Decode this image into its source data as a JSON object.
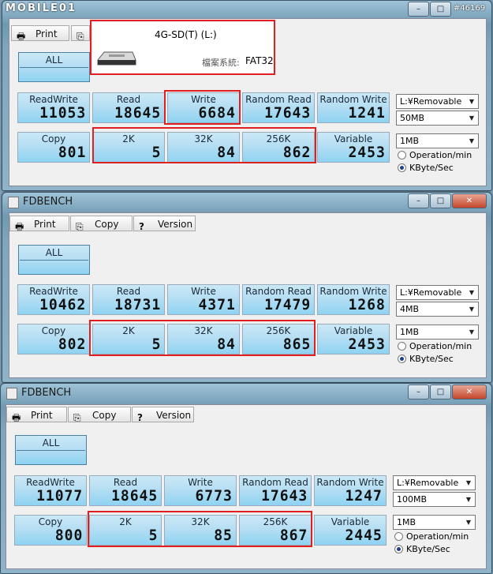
{
  "watermark": {
    "logo": "MOBILE01",
    "id": "#46169"
  },
  "drive_info": {
    "name": "4G-SD(T) (L:)",
    "fs_label": "檔案系統:",
    "fs_value": "FAT32"
  },
  "windows": [
    {
      "title": "",
      "toolbar": {
        "print": "Print",
        "copy": "",
        "version": ""
      },
      "tiles": {
        "all": "ALL",
        "row1": [
          {
            "label": "ReadWrite",
            "value": "11053"
          },
          {
            "label": "Read",
            "value": "18645"
          },
          {
            "label": "Write",
            "value": "6684"
          },
          {
            "label": "Random Read",
            "value": "17643"
          },
          {
            "label": "Random Write",
            "value": "1241"
          }
        ],
        "row2": [
          {
            "label": "Copy",
            "value": "801"
          },
          {
            "label": "2K",
            "value": "5"
          },
          {
            "label": "32K",
            "value": "84"
          },
          {
            "label": "256K",
            "value": "862"
          },
          {
            "label": "Variable",
            "value": "2453"
          }
        ]
      },
      "drive_combo": "L:¥Removable",
      "size_combo": "50MB",
      "block_combo": "1MB",
      "radio_ops": "Operation/min",
      "radio_kb": "KByte/Sec"
    },
    {
      "title": "FDBENCH",
      "toolbar": {
        "print": "Print",
        "copy": "Copy",
        "version": "Version"
      },
      "tiles": {
        "all": "ALL",
        "row1": [
          {
            "label": "ReadWrite",
            "value": "10462"
          },
          {
            "label": "Read",
            "value": "18731"
          },
          {
            "label": "Write",
            "value": "4371"
          },
          {
            "label": "Random Read",
            "value": "17479"
          },
          {
            "label": "Random Write",
            "value": "1268"
          }
        ],
        "row2": [
          {
            "label": "Copy",
            "value": "802"
          },
          {
            "label": "2K",
            "value": "5"
          },
          {
            "label": "32K",
            "value": "84"
          },
          {
            "label": "256K",
            "value": "865"
          },
          {
            "label": "Variable",
            "value": "2453"
          }
        ]
      },
      "drive_combo": "L:¥Removable",
      "size_combo": "4MB",
      "block_combo": "1MB",
      "radio_ops": "Operation/min",
      "radio_kb": "KByte/Sec"
    },
    {
      "title": "FDBENCH",
      "toolbar": {
        "print": "Print",
        "copy": "Copy",
        "version": "Version"
      },
      "tiles": {
        "all": "ALL",
        "row1": [
          {
            "label": "ReadWrite",
            "value": "11077"
          },
          {
            "label": "Read",
            "value": "18645"
          },
          {
            "label": "Write",
            "value": "6773"
          },
          {
            "label": "Random Read",
            "value": "17643"
          },
          {
            "label": "Random Write",
            "value": "1247"
          }
        ],
        "row2": [
          {
            "label": "Copy",
            "value": "800"
          },
          {
            "label": "2K",
            "value": "5"
          },
          {
            "label": "32K",
            "value": "85"
          },
          {
            "label": "256K",
            "value": "867"
          },
          {
            "label": "Variable",
            "value": "2445"
          }
        ]
      },
      "drive_combo": "L:¥Removable",
      "size_combo": "100MB",
      "block_combo": "1MB",
      "radio_ops": "Operation/min",
      "radio_kb": "KByte/Sec"
    }
  ]
}
